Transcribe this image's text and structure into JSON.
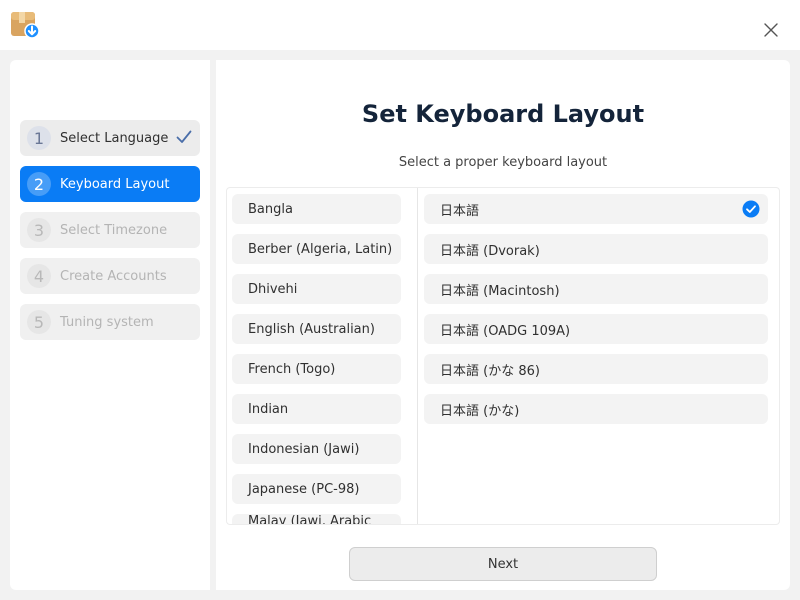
{
  "window": {
    "app_icon": "installer-package-icon",
    "close_icon": "close-icon"
  },
  "steps": [
    {
      "number": "1",
      "label": "Select Language",
      "state": "done"
    },
    {
      "number": "2",
      "label": "Keyboard Layout",
      "state": "active"
    },
    {
      "number": "3",
      "label": "Select Timezone",
      "state": "pending"
    },
    {
      "number": "4",
      "label": "Create Accounts",
      "state": "pending"
    },
    {
      "number": "5",
      "label": "Tuning system",
      "state": "pending"
    }
  ],
  "main": {
    "title": "Set Keyboard Layout",
    "subtitle": "Select a proper keyboard layout",
    "layouts": [
      "Bangla",
      "Berber (Algeria, Latin)",
      "Dhivehi",
      "English (Australian)",
      "French (Togo)",
      "Indian",
      "Indonesian (Jawi)",
      "Japanese (PC-98)",
      "Malay (Jawi, Arabic Keyboard)"
    ],
    "variants": [
      "日本語",
      "日本語 (Dvorak)",
      "日本語 (Macintosh)",
      "日本語 (OADG 109A)",
      "日本語 (かな 86)",
      "日本語 (かな)"
    ],
    "selected_variant": "日本語",
    "next_label": "Next"
  },
  "colors": {
    "accent": "#0a7cf5",
    "background": "#f2f2f2",
    "panel": "#ffffff"
  }
}
